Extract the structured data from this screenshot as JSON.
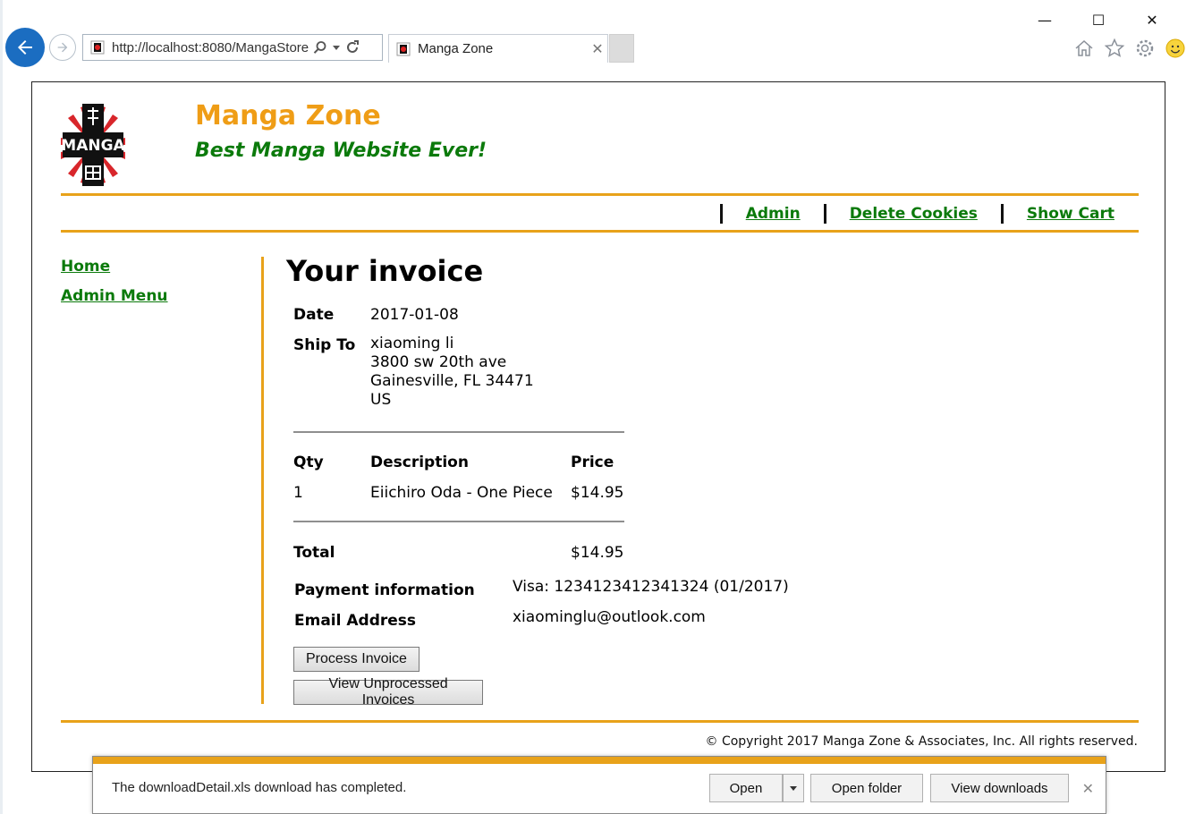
{
  "browser": {
    "url": "http://localhost:8080/MangaStore",
    "tab_title": "Manga Zone",
    "window_controls": {
      "minimize": "—",
      "maximize": "☐",
      "close": "✕"
    }
  },
  "site": {
    "title": "Manga Zone",
    "tagline": "Best Manga Website Ever!",
    "logo_text": "MANGA",
    "colors": {
      "accent": "#e8a21a",
      "title": "#ef9d16",
      "link": "#0b7a0b"
    }
  },
  "top_nav": {
    "admin": "Admin",
    "delete_cookies": "Delete Cookies",
    "show_cart": "Show Cart"
  },
  "side_nav": {
    "home": "Home",
    "admin_menu": "Admin Menu"
  },
  "invoice": {
    "heading": "Your invoice",
    "date_label": "Date",
    "date": "2017-01-08",
    "ship_to_label": "Ship To",
    "ship_to": [
      "xiaoming li",
      "3800 sw 20th ave",
      "Gainesville, FL 34471",
      "US"
    ],
    "columns": {
      "qty": "Qty",
      "description": "Description",
      "price": "Price"
    },
    "items": [
      {
        "qty": "1",
        "description": "Eiichiro Oda - One Piece",
        "price": "$14.95"
      }
    ],
    "total_label": "Total",
    "total": "$14.95",
    "payment_label": "Payment information",
    "payment": "Visa: 1234123412341324 (01/2017)",
    "email_label": "Email Address",
    "email": "xiaominglu@outlook.com",
    "process_button": "Process Invoice",
    "view_button": "View Unprocessed Invoices"
  },
  "footer": {
    "copyright": "© Copyright 2017 Manga Zone & Associates, Inc. All rights reserved."
  },
  "download_bar": {
    "message": "The downloadDetail.xls download has completed.",
    "open": "Open",
    "open_folder": "Open folder",
    "view_downloads": "View downloads",
    "close": "✕"
  }
}
